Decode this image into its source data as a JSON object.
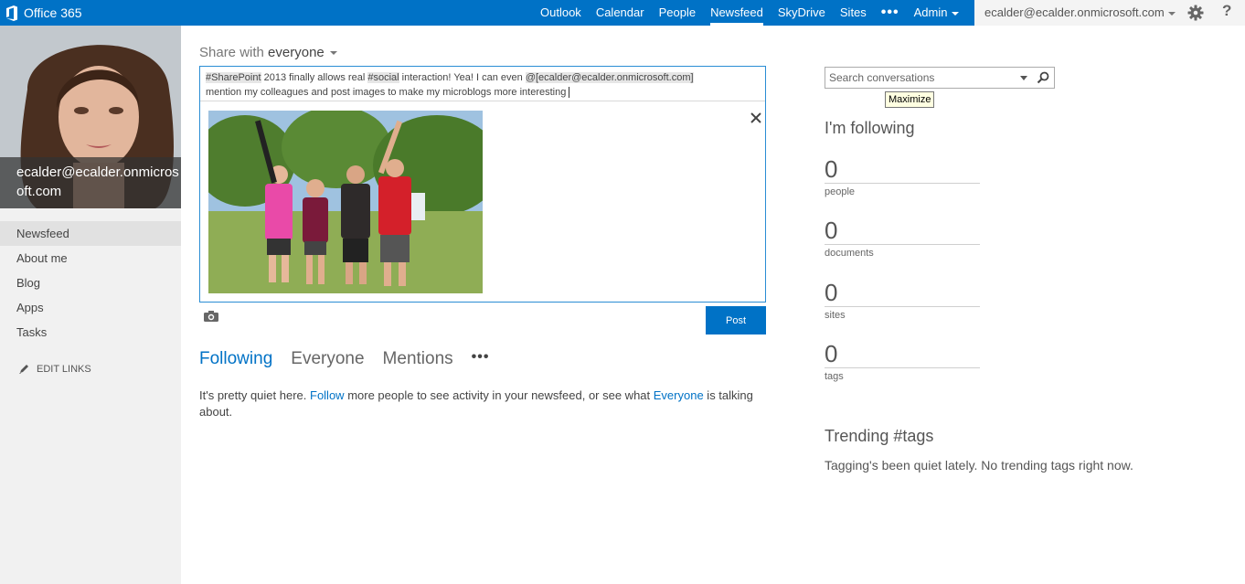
{
  "app": {
    "name": "Office 365"
  },
  "topnav": {
    "items": [
      {
        "label": "Outlook",
        "active": false
      },
      {
        "label": "Calendar",
        "active": false
      },
      {
        "label": "People",
        "active": false
      },
      {
        "label": "Newsfeed",
        "active": true
      },
      {
        "label": "SkyDrive",
        "active": false
      },
      {
        "label": "Sites",
        "active": false
      }
    ],
    "more": "•••",
    "admin": "Admin"
  },
  "user": {
    "email": "ecalder@ecalder.onmicrosoft.com",
    "profile_name": "ecalder@ecalder.onmicrosoft.com",
    "help": "?"
  },
  "sidebar": {
    "items": [
      {
        "label": "Newsfeed",
        "selected": true
      },
      {
        "label": "About me",
        "selected": false
      },
      {
        "label": "Blog",
        "selected": false
      },
      {
        "label": "Apps",
        "selected": false
      },
      {
        "label": "Tasks",
        "selected": false
      }
    ],
    "edit_links": "EDIT LINKS"
  },
  "share": {
    "prefix": "Share with",
    "target": "everyone"
  },
  "composer": {
    "hashtag1": "#SharePoint",
    "text1": " 2013 finally allows real ",
    "hashtag2": "#social",
    "text2": " interaction! Yea! I can even ",
    "mention": "@[ecalder@ecalder.onmicrosoft.com]",
    "text3": "mention my colleagues and post images to make my microblogs more interesting",
    "post_label": "Post"
  },
  "feed": {
    "tabs": [
      {
        "label": "Following",
        "active": true
      },
      {
        "label": "Everyone",
        "active": false
      },
      {
        "label": "Mentions",
        "active": false
      }
    ],
    "more": "•••",
    "quiet_prefix": "It's pretty quiet here. ",
    "follow_link": "Follow",
    "quiet_middle": " more people to see activity in your newsfeed, or see what ",
    "everyone_link": "Everyone",
    "quiet_suffix": " is talking about."
  },
  "search": {
    "placeholder": "Search conversations",
    "tooltip": "Maximize"
  },
  "following": {
    "title": "I'm following",
    "stats": [
      {
        "value": "0",
        "label": "people"
      },
      {
        "value": "0",
        "label": "documents"
      },
      {
        "value": "0",
        "label": "sites"
      },
      {
        "value": "0",
        "label": "tags"
      }
    ]
  },
  "trending": {
    "title": "Trending #tags",
    "text": "Tagging's been quiet lately. No trending tags right now."
  },
  "colors": {
    "brand": "#0072c6",
    "sidebar_bg": "#f1f1f1",
    "composer_border": "#2a8dd4"
  },
  "icons": [
    "office-logo-icon",
    "gear-icon",
    "help-icon",
    "pencil-icon",
    "close-icon",
    "camera-icon",
    "search-icon",
    "chevron-down-icon"
  ]
}
